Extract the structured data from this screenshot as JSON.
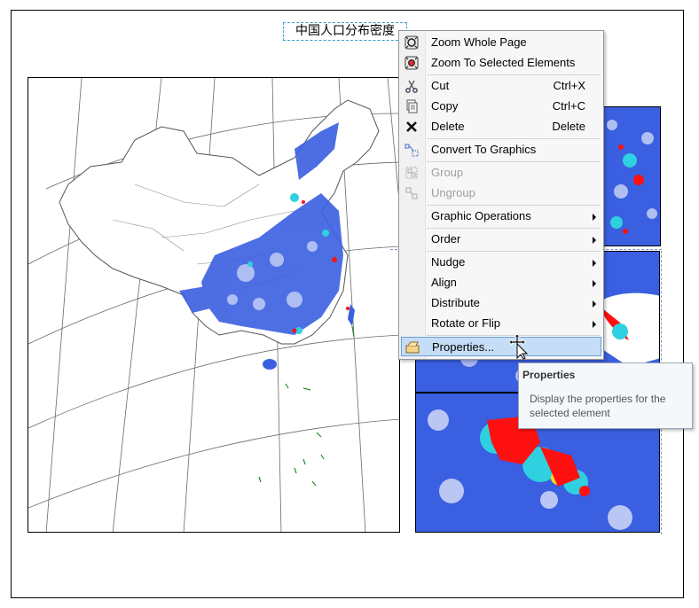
{
  "map": {
    "title": "中国人口分布密度"
  },
  "context_menu": {
    "items": [
      {
        "label": "Zoom Whole Page",
        "icon": "zoom-whole-page-icon"
      },
      {
        "label": "Zoom To Selected Elements",
        "icon": "zoom-selected-icon"
      },
      {
        "label": "Cut",
        "shortcut": "Ctrl+X",
        "icon": "scissors-icon"
      },
      {
        "label": "Copy",
        "shortcut": "Ctrl+C",
        "icon": "copy-icon"
      },
      {
        "label": "Delete",
        "shortcut": "Delete",
        "icon": "delete-x-icon"
      },
      {
        "label": "Convert To Graphics",
        "icon": "convert-graphics-icon"
      },
      {
        "label": "Group",
        "disabled": true,
        "icon": "group-icon"
      },
      {
        "label": "Ungroup",
        "disabled": true,
        "icon": "ungroup-icon"
      },
      {
        "label": "Graphic Operations",
        "submenu": true
      },
      {
        "label": "Order",
        "submenu": true
      },
      {
        "label": "Nudge",
        "submenu": true
      },
      {
        "label": "Align",
        "submenu": true
      },
      {
        "label": "Distribute",
        "submenu": true
      },
      {
        "label": "Rotate or Flip",
        "submenu": true
      },
      {
        "label": "Properties...",
        "icon": "properties-icon",
        "highlighted": true
      }
    ]
  },
  "tooltip": {
    "title": "Properties",
    "body": "Display the properties for the selected element"
  },
  "colors": {
    "menu_hover": "#c5ddf6",
    "density_low": "#3a5fe0",
    "density_mid": "#2fd0e0",
    "density_high": "#ff1010",
    "islands": "#2a8a2a"
  }
}
